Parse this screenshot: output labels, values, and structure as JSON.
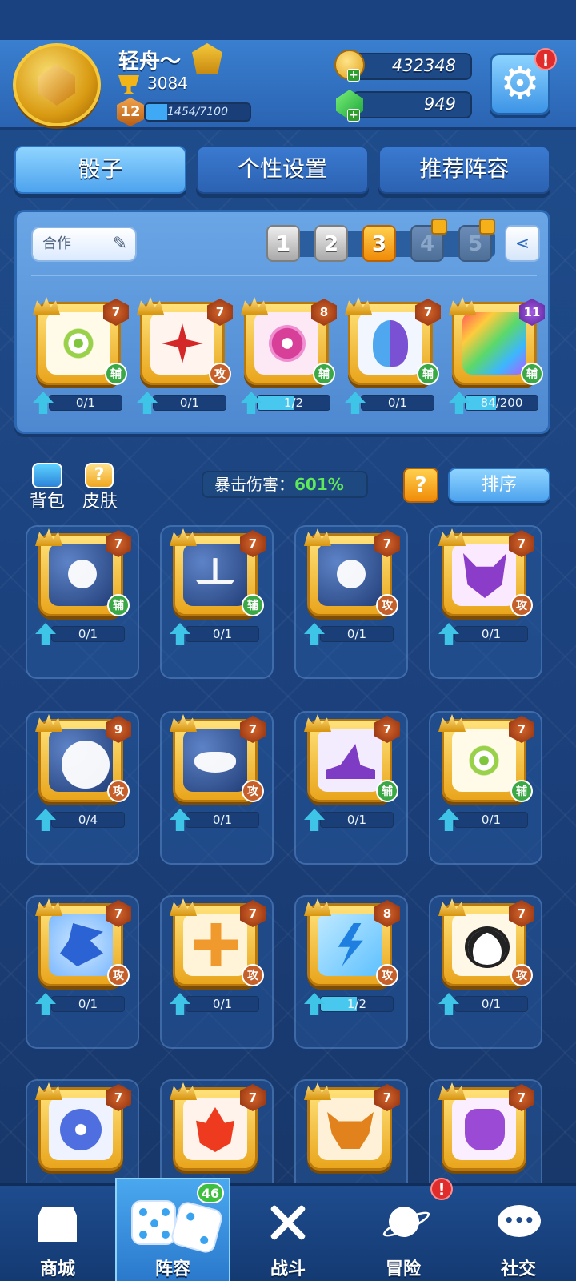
{
  "player": {
    "name": "轻舟～",
    "trophies": "3084",
    "level": "12",
    "xp": "1454/7100",
    "xp_fraction": 0.205
  },
  "currency": {
    "coins": "432348",
    "gems": "949"
  },
  "settings": {
    "alert": "!"
  },
  "tabs": [
    {
      "label": "骰子",
      "active": true
    },
    {
      "label": "个性设置",
      "active": false
    },
    {
      "label": "推荐阵容",
      "active": false
    }
  ],
  "deck": {
    "name": "合作",
    "slots": [
      {
        "label": "1",
        "state": "normal"
      },
      {
        "label": "2",
        "state": "normal"
      },
      {
        "label": "3",
        "state": "selected"
      },
      {
        "label": "4",
        "state": "locked"
      },
      {
        "label": "5",
        "state": "locked"
      }
    ],
    "dice": [
      {
        "icon": "dandelion-dice-icon",
        "tier": "7",
        "role": "辅",
        "progress": "0/1",
        "fraction": 0
      },
      {
        "icon": "shuriken-dice-icon",
        "tier": "7",
        "role": "攻",
        "progress": "0/1",
        "fraction": 0
      },
      {
        "icon": "eye-dice-icon",
        "tier": "8",
        "role": "辅",
        "progress": "1/2",
        "fraction": 0.5
      },
      {
        "icon": "mask-dice-icon",
        "tier": "7",
        "role": "辅",
        "progress": "0/1",
        "fraction": 0
      },
      {
        "icon": "puzzle-dice-icon",
        "tier": "11",
        "role": "辅",
        "progress": "84/200",
        "fraction": 0.42
      }
    ]
  },
  "toolbar": {
    "backpack": "背包",
    "skin": "皮肤",
    "skin_glyph": "?",
    "crit_label": "暴击伤害：",
    "crit_value": "601%",
    "help": "?",
    "sort": "排序"
  },
  "collection": [
    {
      "icon": "aries-dice-icon",
      "art": "g-night",
      "tier": "7",
      "role": "辅",
      "progress": "0/1",
      "fraction": 0
    },
    {
      "icon": "libra-dice-icon",
      "art": "g-night g-libra",
      "tier": "7",
      "role": "辅",
      "progress": "0/1",
      "fraction": 0
    },
    {
      "icon": "aquarius-dice-icon",
      "art": "g-night",
      "tier": "7",
      "role": "攻",
      "progress": "0/1",
      "fraction": 0
    },
    {
      "icon": "demon-dice-icon",
      "art": "g-demon",
      "tier": "7",
      "role": "攻",
      "progress": "0/1",
      "fraction": 0
    },
    {
      "icon": "sagittarius-dice-icon",
      "art": "g-night g-bow",
      "tier": "9",
      "role": "攻",
      "progress": "0/4",
      "fraction": 0
    },
    {
      "icon": "scorpio-dice-icon",
      "art": "g-night g-scorpio",
      "tier": "7",
      "role": "攻",
      "progress": "0/1",
      "fraction": 0
    },
    {
      "icon": "witch-hat-dice-icon",
      "art": "g-witch",
      "tier": "7",
      "role": "辅",
      "progress": "0/1",
      "fraction": 0
    },
    {
      "icon": "dandelion-dice-icon",
      "art": "g-dandelion",
      "tier": "7",
      "role": "辅",
      "progress": "0/1",
      "fraction": 0
    },
    {
      "icon": "dragon-dice-icon",
      "art": "g-dragon",
      "tier": "7",
      "role": "攻",
      "progress": "0/1",
      "fraction": 0
    },
    {
      "icon": "cross-dice-icon",
      "art": "g-cross",
      "tier": "7",
      "role": "攻",
      "progress": "0/1",
      "fraction": 0
    },
    {
      "icon": "lightning-dice-icon",
      "art": "g-lightning",
      "tier": "8",
      "role": "攻",
      "progress": "1/2",
      "fraction": 0.5
    },
    {
      "icon": "panda-dice-icon",
      "art": "g-panda",
      "tier": "7",
      "role": "攻",
      "progress": "0/1",
      "fraction": 0
    },
    {
      "icon": "flower-dice-icon",
      "art": "g-flower",
      "tier": "7",
      "role": "",
      "progress": "",
      "fraction": 0
    },
    {
      "icon": "fire-dice-icon",
      "art": "g-fire",
      "tier": "7",
      "role": "",
      "progress": "",
      "fraction": 0
    },
    {
      "icon": "ox-dice-icon",
      "art": "g-ox",
      "tier": "7",
      "role": "",
      "progress": "",
      "fraction": 0
    },
    {
      "icon": "jar-dice-icon",
      "art": "g-jar",
      "tier": "7",
      "role": "",
      "progress": "",
      "fraction": 0
    }
  ],
  "nav": [
    {
      "label": "商城",
      "icon": "shop-icon"
    },
    {
      "label": "阵容",
      "icon": "dice-icon",
      "count": "46"
    },
    {
      "label": "战斗",
      "icon": "swords-icon"
    },
    {
      "label": "冒险",
      "icon": "planet-icon",
      "alert": "!"
    },
    {
      "label": "社交",
      "icon": "chat-icon"
    }
  ]
}
